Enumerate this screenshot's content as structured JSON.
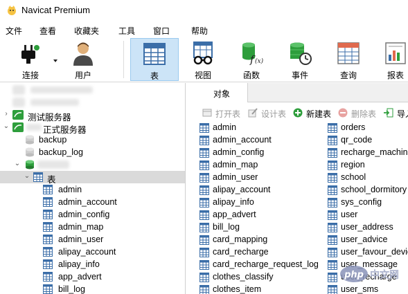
{
  "app": {
    "title": "Navicat Premium"
  },
  "menu": [
    "文件",
    "查看",
    "收藏夹",
    "工具",
    "窗口",
    "帮助"
  ],
  "toolbar": [
    {
      "label": "连接",
      "icon": "plug-icon"
    },
    {
      "label": "用户",
      "icon": "user-icon"
    },
    {
      "label": "表",
      "icon": "table-icon",
      "active": true
    },
    {
      "label": "视图",
      "icon": "view-glasses-icon"
    },
    {
      "label": "函数",
      "icon": "function-icon"
    },
    {
      "label": "事件",
      "icon": "event-clock-icon"
    },
    {
      "label": "查询",
      "icon": "query-icon"
    },
    {
      "label": "报表",
      "icon": "report-icon"
    }
  ],
  "tree": {
    "servers": [
      "测试服务器",
      "正式服务器"
    ],
    "databases": [
      "backup",
      "backup_log"
    ],
    "table_node": "表",
    "tables": [
      "admin",
      "admin_account",
      "admin_config",
      "admin_map",
      "admin_user",
      "alipay_account",
      "alipay_info",
      "app_advert",
      "bill_log"
    ]
  },
  "tabs": {
    "objects": "对象"
  },
  "object_toolbar": {
    "open": "打开表",
    "design": "设计表",
    "new": "新建表",
    "delete": "删除表",
    "import": "导入"
  },
  "objects": {
    "col1": [
      "admin",
      "admin_account",
      "admin_config",
      "admin_map",
      "admin_user",
      "alipay_account",
      "alipay_info",
      "app_advert",
      "bill_log",
      "card_mapping",
      "card_recharge",
      "card_recharge_request_log",
      "clothes_classify",
      "clothes_item"
    ],
    "col2": [
      "orders",
      "qr_code",
      "recharge_machine",
      "region",
      "school",
      "school_dormitory",
      "sys_config",
      "user",
      "user_address",
      "user_advice",
      "user_favour_device",
      "user_message",
      "user_recharge",
      "user_sms"
    ]
  },
  "watermark": "php中文网",
  "colors": {
    "accent": "#cce4f7",
    "table_icon": "#3b6ea8",
    "new_green": "#2e9e3c",
    "delete_red": "#d9534f"
  }
}
